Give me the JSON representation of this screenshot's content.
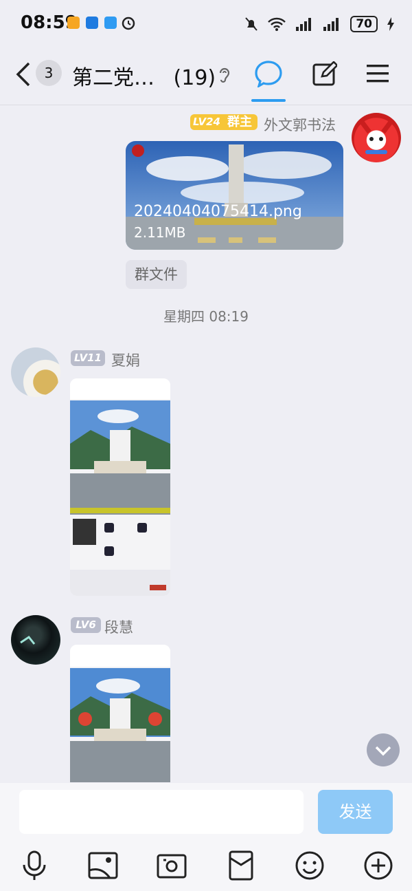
{
  "status_bar": {
    "time": "08:59",
    "battery": "70"
  },
  "header": {
    "badge_count": "3",
    "title": "第二党…",
    "member_count": "(19)"
  },
  "messages": [
    {
      "level": "LV24",
      "role": "群主",
      "sender": "外文郭书法",
      "file_name": "20240404075414.png",
      "file_size": "2.11MB",
      "source_tag": "群文件"
    },
    {
      "level": "LV11",
      "sender": "夏娟"
    },
    {
      "level": "LV6",
      "sender": "段慧"
    }
  ],
  "timestamp": "星期四 08:19",
  "composer": {
    "placeholder": "",
    "send_label": "发送"
  },
  "toolbar": {
    "icons": [
      "microphone-icon",
      "gallery-icon",
      "camera-icon",
      "red-packet-icon",
      "emoji-icon",
      "plus-icon"
    ]
  },
  "colors": {
    "accent": "#2d9cf0",
    "send_disabled": "#8ec9f7",
    "owner_badge": "#f7c638",
    "level_badge": "#b9bccb"
  }
}
